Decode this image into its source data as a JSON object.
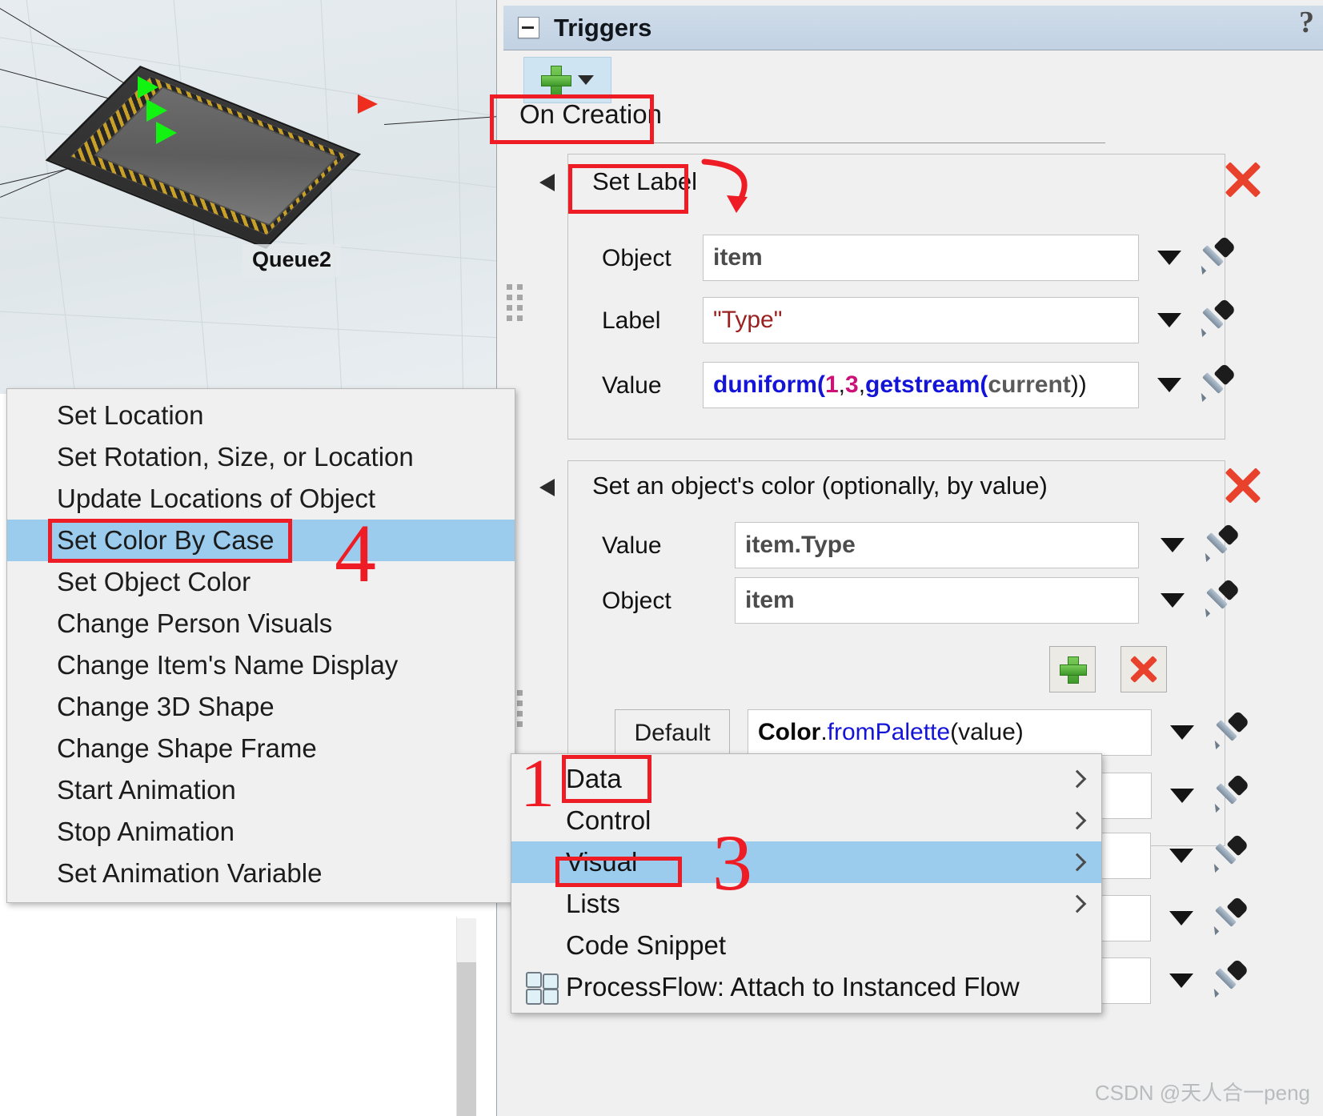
{
  "view3d": {
    "object_label": "Queue2"
  },
  "panel": {
    "title": "Triggers",
    "collapse_icon": "minus-box-icon",
    "help_icon": "question-mark-icon",
    "add_button": {
      "icon": "green-plus-icon",
      "dropdown_icon": "caret-down-icon"
    },
    "tab": "On Creation"
  },
  "cards": [
    {
      "title": "Set Label",
      "collapse_icon": "triangle-collapse-icon",
      "close_icon": "red-x-icon",
      "drag_icon": "drag-dots-icon",
      "fields": [
        {
          "label": "Object",
          "value": "item",
          "value_kind": "plain",
          "dropdown_icon": "caret-down-icon",
          "picker_icon": "eyedropper-icon"
        },
        {
          "label": "Label",
          "value": "\"Type\"",
          "value_kind": "string",
          "dropdown_icon": "caret-down-icon",
          "picker_icon": "eyedropper-icon"
        },
        {
          "label": "Value",
          "value": "duniform(1,3,getstream(current))",
          "value_kind": "code",
          "dropdown_icon": "caret-down-icon",
          "picker_icon": "eyedropper-icon"
        }
      ]
    },
    {
      "title": "Set an object's color (optionally, by value)",
      "collapse_icon": "triangle-collapse-icon",
      "close_icon": "red-x-icon",
      "drag_icon": "drag-dots-icon",
      "fields": [
        {
          "label": "Value",
          "value": "item.Type",
          "value_kind": "plain",
          "dropdown_icon": "caret-down-icon",
          "picker_icon": "eyedropper-icon"
        },
        {
          "label": "Object",
          "value": "item",
          "value_kind": "plain",
          "dropdown_icon": "caret-down-icon",
          "picker_icon": "eyedropper-icon"
        }
      ],
      "row_buttons": {
        "add_icon": "green-plus-icon",
        "remove_icon": "red-x-icon"
      },
      "case_rows": [
        {
          "case_label": "Default",
          "value": "Color.fromPalette(value)",
          "value_kind": "code",
          "dropdown_icon": "caret-down-icon",
          "picker_icon": "eyedropper-icon"
        }
      ],
      "hidden_rows": [
        {
          "dropdown_icon": "caret-down-icon",
          "picker_icon": "eyedropper-icon"
        },
        {
          "dropdown_icon": "caret-down-icon",
          "picker_icon": "eyedropper-icon"
        },
        {
          "dropdown_icon": "caret-down-icon",
          "picker_icon": "eyedropper-icon"
        }
      ]
    }
  ],
  "context_menu": {
    "items": [
      {
        "label": "Data",
        "has_submenu": true,
        "selected": false,
        "icon": null
      },
      {
        "label": "Control",
        "has_submenu": true,
        "selected": false,
        "icon": null
      },
      {
        "label": "Visual",
        "has_submenu": true,
        "selected": true,
        "icon": null
      },
      {
        "label": "Lists",
        "has_submenu": true,
        "selected": false,
        "icon": null
      },
      {
        "label": "Code Snippet",
        "has_submenu": false,
        "selected": false,
        "icon": null
      },
      {
        "label": "ProcessFlow: Attach to Instanced Flow",
        "has_submenu": false,
        "selected": false,
        "icon": "processflow-icon"
      }
    ]
  },
  "submenu": {
    "items": [
      {
        "label": "Set Location",
        "selected": false
      },
      {
        "label": "Set Rotation, Size, or Location",
        "selected": false
      },
      {
        "label": "Update Locations of Object",
        "selected": false
      },
      {
        "label": "Set Color By Case",
        "selected": true
      },
      {
        "label": "Set Object Color",
        "selected": false
      },
      {
        "label": "Change Person Visuals",
        "selected": false
      },
      {
        "label": "Change Item's Name Display",
        "selected": false
      },
      {
        "label": "Change 3D Shape",
        "selected": false
      },
      {
        "label": "Change Shape Frame",
        "selected": false
      },
      {
        "label": "Start Animation",
        "selected": false
      },
      {
        "label": "Stop Animation",
        "selected": false
      },
      {
        "label": "Set Animation Variable",
        "selected": false
      }
    ]
  },
  "annotations": {
    "numbers": [
      {
        "text": "1",
        "target": "Data"
      },
      {
        "text": "3",
        "target": "Visual"
      },
      {
        "text": "4",
        "target": "Set Color By Case"
      }
    ],
    "boxes": [
      "On Creation",
      "Set Label",
      "Data",
      "Visual",
      "Set Color By Case"
    ],
    "color": "#ee1c25"
  },
  "watermark": "CSDN @天人合一peng"
}
